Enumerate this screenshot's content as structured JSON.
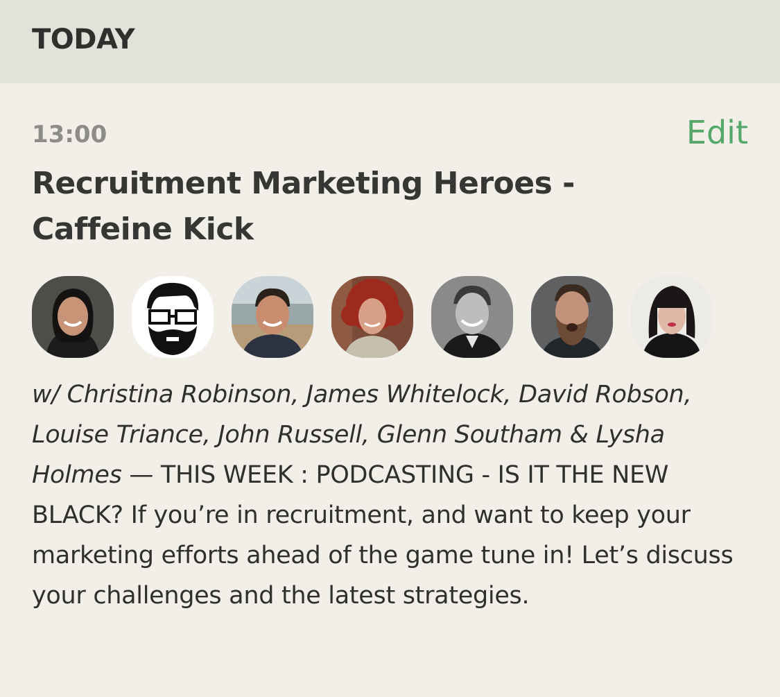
{
  "header": {
    "label": "TODAY"
  },
  "event": {
    "time": "13:00",
    "edit_label": "Edit",
    "title": "Recruitment Marketing Heroes - Caffeine Kick",
    "hosts_text": "w/ Christina Robinson, James Whitelock, David Robson, Louise Triance, John Russell, Glenn Southam & Lysha Holmes",
    "separator": " — ",
    "description_text": "THIS WEEK :  PODCASTING - IS IT THE NEW BLACK? If you’re in recruitment, and want to keep your marketing efforts ahead of the game tune in! Let’s discuss your challenges and the latest strategies.",
    "speaker_avatars": [
      {
        "icon": "avatar-photo",
        "bg": "#4a4a48"
      },
      {
        "icon": "avatar-illustration-beard-glasses",
        "bg": "#ffffff"
      },
      {
        "icon": "avatar-photo",
        "bg": "#bfc7c9"
      },
      {
        "icon": "avatar-photo",
        "bg": "#8a4a3a"
      },
      {
        "icon": "avatar-photo",
        "bg": "#7a7a7a"
      },
      {
        "icon": "avatar-photo",
        "bg": "#6a6a68"
      },
      {
        "icon": "avatar-photo",
        "bg": "#e8e6e2"
      }
    ]
  },
  "colors": {
    "background": "#f1efe7",
    "header_bg": "#e2e2da",
    "accent_green": "#56a86a",
    "time_gray": "#8d8c88",
    "text_dark": "#333331"
  }
}
